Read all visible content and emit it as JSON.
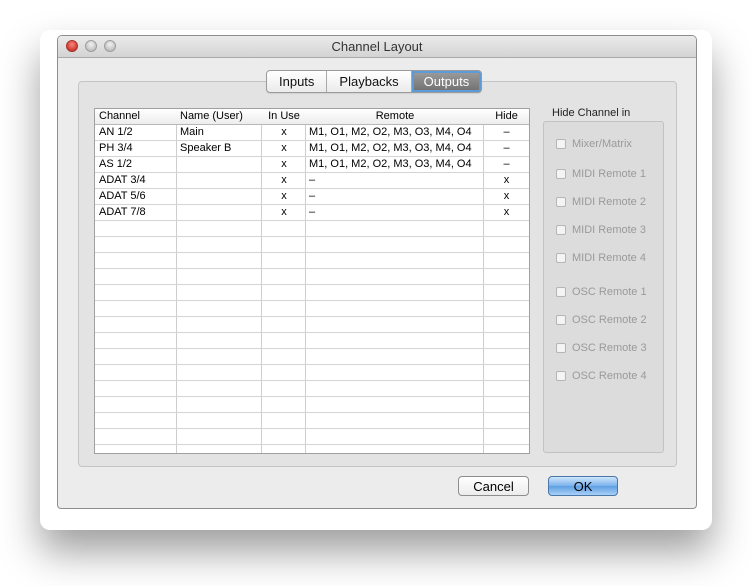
{
  "window": {
    "title": "Channel Layout"
  },
  "tabs": [
    {
      "label": "Inputs",
      "selected": false
    },
    {
      "label": "Playbacks",
      "selected": false
    },
    {
      "label": "Outputs",
      "selected": true
    }
  ],
  "table": {
    "headers": {
      "channel": "Channel",
      "name": "Name (User)",
      "in_use": "In Use",
      "remote": "Remote",
      "hide": "Hide"
    },
    "rows": [
      {
        "channel": "AN 1/2",
        "name": "Main",
        "in_use": "x",
        "remote": "M1, O1, M2, O2, M3, O3, M4, O4",
        "hide": "–"
      },
      {
        "channel": "PH 3/4",
        "name": "Speaker B",
        "in_use": "x",
        "remote": "M1, O1, M2, O2, M3, O3, M4, O4",
        "hide": "–"
      },
      {
        "channel": "AS 1/2",
        "name": "",
        "in_use": "x",
        "remote": "M1, O1, M2, O2, M3, O3, M4, O4",
        "hide": "–"
      },
      {
        "channel": "ADAT 3/4",
        "name": "",
        "in_use": "x",
        "remote": "–",
        "hide": "x"
      },
      {
        "channel": "ADAT 5/6",
        "name": "",
        "in_use": "x",
        "remote": "–",
        "hide": "x"
      },
      {
        "channel": "ADAT 7/8",
        "name": "",
        "in_use": "x",
        "remote": "–",
        "hide": "x"
      }
    ]
  },
  "hide_panel": {
    "label": "Hide Channel in",
    "items": [
      {
        "label": "Mixer/Matrix",
        "checked": false
      },
      {
        "label": "MIDI Remote 1",
        "checked": false
      },
      {
        "label": "MIDI Remote 2",
        "checked": false
      },
      {
        "label": "MIDI Remote 3",
        "checked": false
      },
      {
        "label": "MIDI Remote 4",
        "checked": false
      },
      {
        "label": "OSC Remote 1",
        "checked": false
      },
      {
        "label": "OSC Remote 2",
        "checked": false
      },
      {
        "label": "OSC Remote 3",
        "checked": false
      },
      {
        "label": "OSC Remote 4",
        "checked": false
      }
    ]
  },
  "buttons": {
    "cancel": "Cancel",
    "ok": "OK"
  },
  "colors": {
    "accent": "#5f9fe2",
    "selected_tab": "#7a7a7a"
  }
}
